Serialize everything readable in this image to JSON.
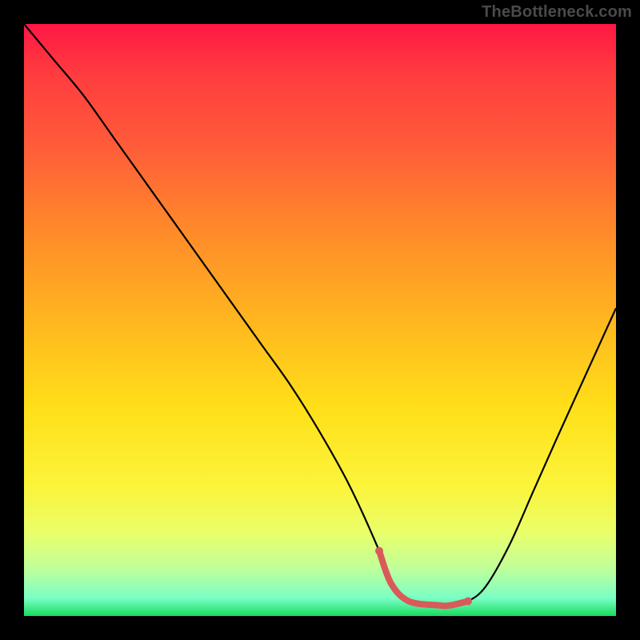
{
  "attribution": "TheBottleneck.com",
  "chart_data": {
    "type": "line",
    "title": "",
    "xlabel": "",
    "ylabel": "",
    "xlim": [
      0,
      100
    ],
    "ylim": [
      0,
      100
    ],
    "grid": false,
    "legend": false,
    "x": [
      0,
      5,
      10,
      15,
      20,
      25,
      30,
      35,
      40,
      45,
      50,
      55,
      60,
      62,
      65,
      70,
      72,
      75,
      78,
      82,
      86,
      90,
      95,
      100
    ],
    "values": [
      100,
      94,
      88,
      81,
      74,
      67,
      60,
      53,
      46,
      39,
      31,
      22,
      11,
      5.5,
      2.5,
      1.8,
      1.8,
      2.5,
      5,
      12,
      21,
      30,
      41,
      52
    ],
    "marker_segment": {
      "x": [
        60,
        62,
        65,
        70,
        72,
        75
      ],
      "values": [
        11,
        5.5,
        2.5,
        1.8,
        1.8,
        2.5
      ],
      "color": "#d85a5a"
    },
    "line_color": "#000000",
    "background": {
      "type": "vertical-gradient",
      "stops": [
        {
          "pos": 0,
          "color": "#ff1744"
        },
        {
          "pos": 0.5,
          "color": "#ffe019"
        },
        {
          "pos": 1,
          "color": "#18db5e"
        }
      ]
    }
  }
}
